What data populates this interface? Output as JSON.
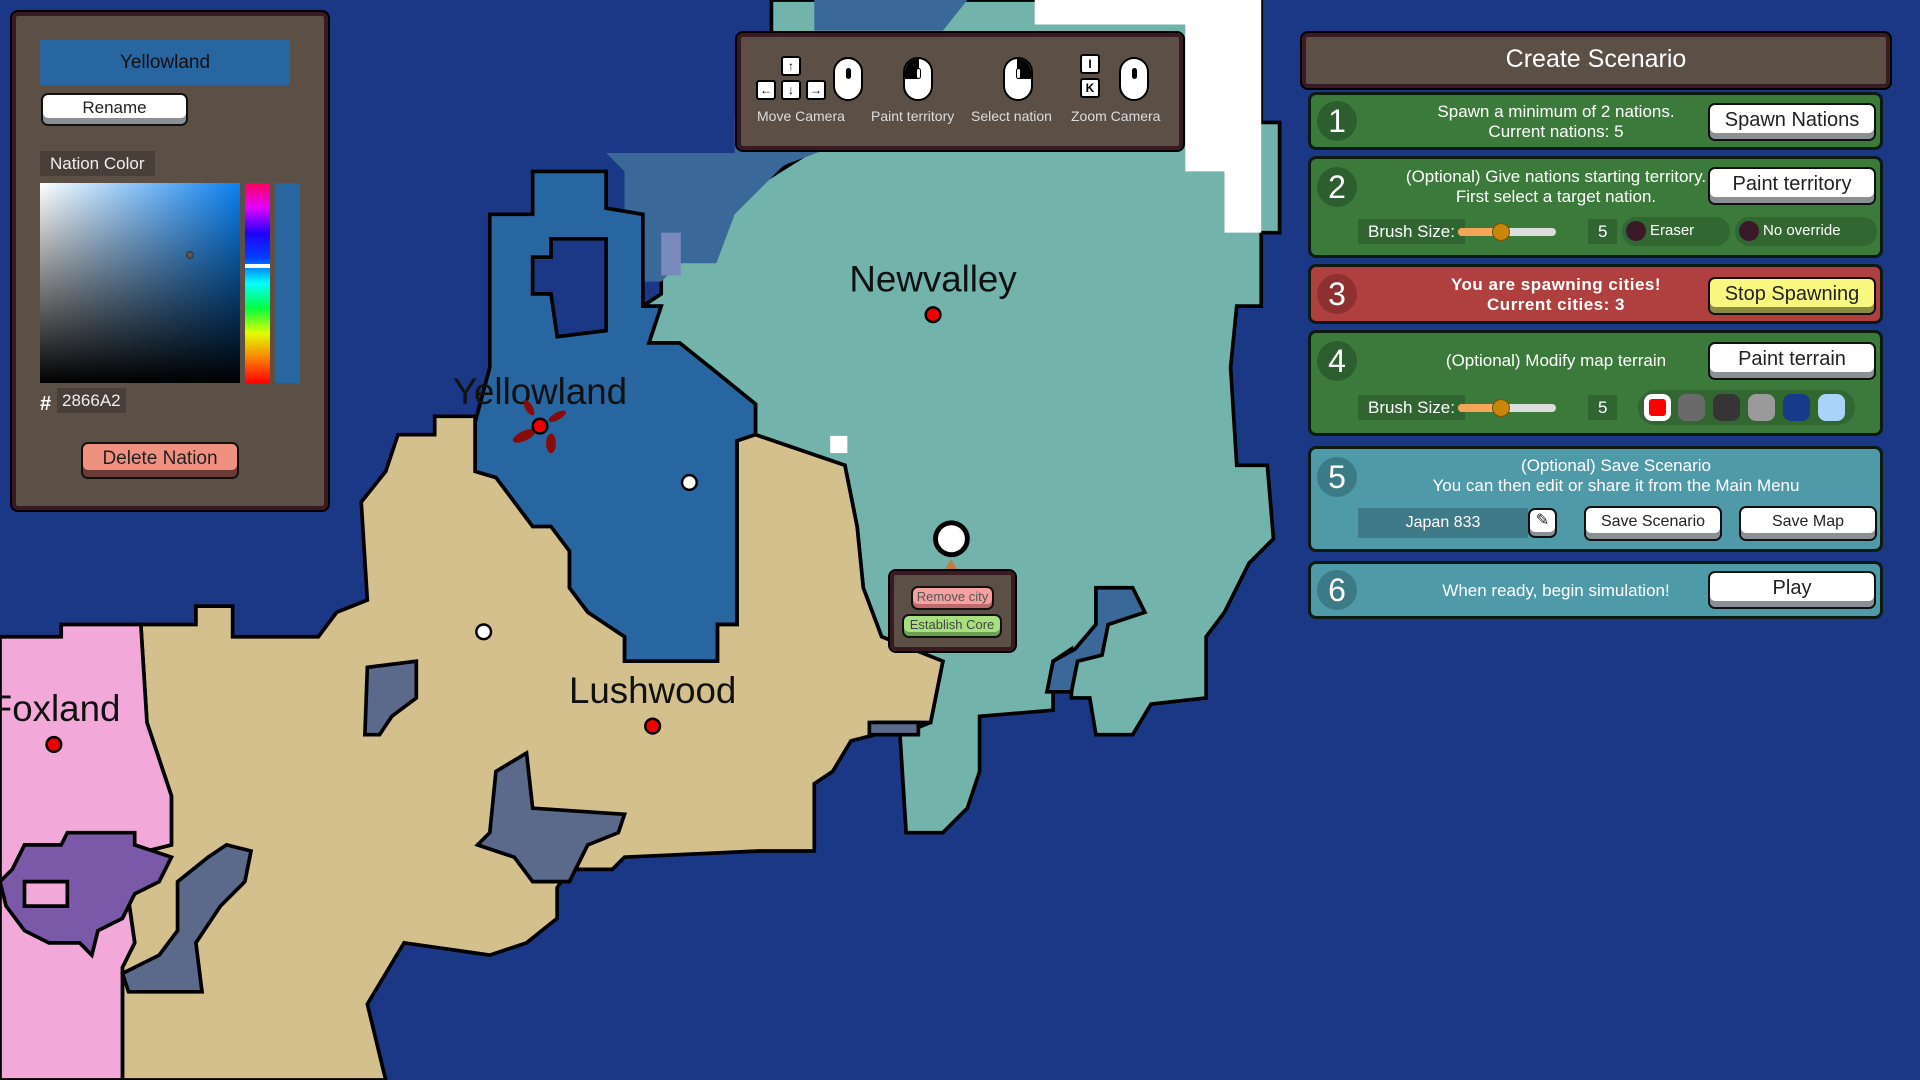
{
  "map": {
    "nations": [
      {
        "name": "Newvalley",
        "color": "#72b3ab"
      },
      {
        "name": "Yellowland",
        "color": "#2866A2"
      },
      {
        "name": "Lushwood",
        "color": "#d4c08c"
      },
      {
        "name": "Foxland",
        "color": "#f2a8d8"
      }
    ],
    "ocean_color": "#1b3886"
  },
  "nation_panel": {
    "name": "Yellowland",
    "rename": "Rename",
    "color_label": "Nation Color",
    "hash": "#",
    "hex": "2866A2",
    "delete": "Delete Nation"
  },
  "controls": {
    "move": "Move Camera",
    "paint": "Paint territory",
    "select": "Select nation",
    "zoom": "Zoom Camera",
    "keys": {
      "up": "↑",
      "left": "←",
      "down": "↓",
      "right": "→",
      "i": "I",
      "k": "K"
    }
  },
  "city_popup": {
    "remove": "Remove city",
    "core": "Establish Core"
  },
  "scenario": {
    "title": "Create Scenario",
    "s1": {
      "num": "1",
      "line1": "Spawn a minimum of 2 nations.",
      "line2": "Current nations: 5",
      "button": "Spawn Nations"
    },
    "s2": {
      "num": "2",
      "line1": "(Optional) Give nations starting territory.",
      "line2": "First select a target nation.",
      "button": "Paint territory",
      "brush_label": "Brush Size:",
      "brush_value": "5",
      "brush_fraction": 0.45,
      "eraser": "Eraser",
      "override": "No override"
    },
    "s3": {
      "num": "3",
      "line1": "You are spawning cities!",
      "line2": "Current cities: 3",
      "button": "Stop Spawning"
    },
    "s4": {
      "num": "4",
      "line1": "(Optional) Modify map terrain",
      "button": "Paint terrain",
      "brush_label": "Brush Size:",
      "brush_value": "5",
      "terrain_colors": [
        "#ff0000",
        "#6a6a6a",
        "#353535",
        "#9a9a9a",
        "#173a8a",
        "#a8d4fa"
      ]
    },
    "s5": {
      "num": "5",
      "line1": "(Optional) Save Scenario",
      "line2": "You can then edit or share it from the Main Menu",
      "name_value": "Japan 833",
      "save_scenario": "Save Scenario",
      "save_map": "Save Map"
    },
    "s6": {
      "num": "6",
      "line1": "When ready, begin simulation!",
      "button": "Play"
    }
  }
}
